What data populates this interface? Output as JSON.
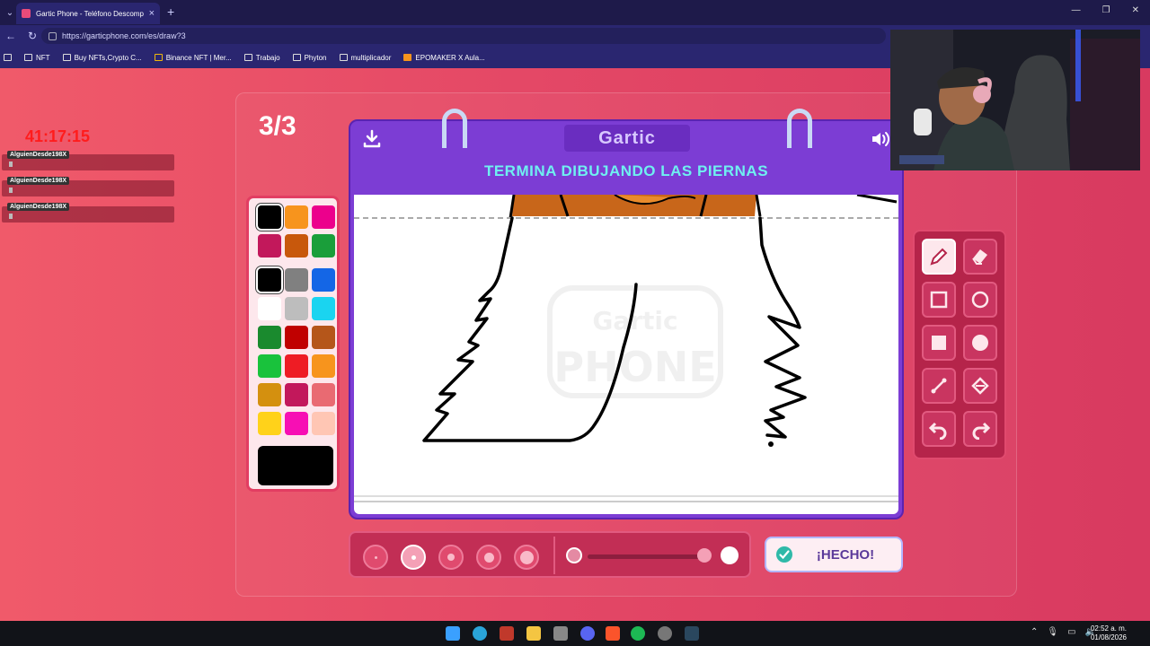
{
  "browser": {
    "tab_title": "Gartic Phone - Teléfono Descomp...",
    "url": "https://garticphone.com/es/draw?3",
    "bookmarks": [
      "NFT",
      "Buy NFTs,Crypto C...",
      "Binance NFT | Mer...",
      "Trabajo",
      "Phyton",
      "multiplicador",
      "EPOMAKER X Aula..."
    ]
  },
  "overlay": {
    "timer": "41:17:15",
    "chat_names": [
      "AlguienDesde198X",
      "AlguienDesde198X",
      "AlguienDesde198X"
    ]
  },
  "game": {
    "round": "3/3",
    "logo": "Gartic",
    "instruction": "TERMINA DIBUJANDO LAS PIERNAS",
    "done_label": "¡HECHO!",
    "watermark_top": "Gartic",
    "watermark_bottom": "PHONE"
  },
  "palette": [
    "#000000",
    "#f7941d",
    "#ec008c",
    "#c2185b",
    "#c8580c",
    "#1a9e3a",
    "#000000",
    "#808080",
    "#1466e6",
    "#ffffff",
    "#bdbdbd",
    "#1ad4f0",
    "#1a8a2e",
    "#c00000",
    "#b5561a",
    "#19c23c",
    "#ee1c24",
    "#f7941d",
    "#d4900f",
    "#c2185b",
    "#e96a72",
    "#ffd21a",
    "#f70fb4",
    "#ffc6b4"
  ],
  "selected_color": "#000000",
  "brush_sizes_selected": 1,
  "taskbar": {
    "time": "02:52 a. m.",
    "date": "01/08/2026"
  }
}
